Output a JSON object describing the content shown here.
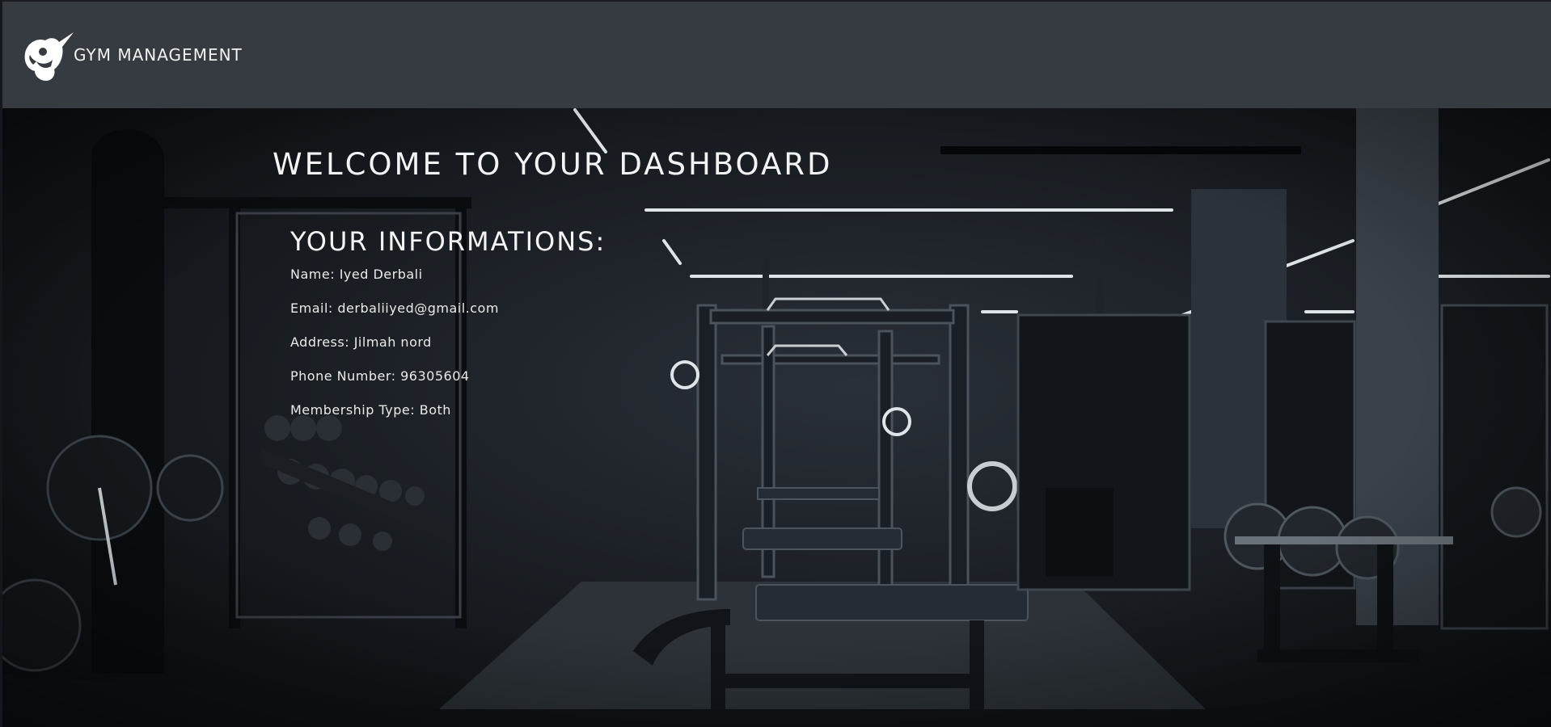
{
  "header": {
    "brand": "GYM MANAGEMENT",
    "logo_icon": "gym-mascot-logo"
  },
  "dashboard": {
    "welcome": "WELCOME TO YOUR DASHBOARD",
    "info_title": "YOUR INFORMATIONS:",
    "fields": [
      {
        "label": "Name:",
        "value": "Iyed Derbali"
      },
      {
        "label": "Email:",
        "value": "derbaliiyed@gmail.com"
      },
      {
        "label": "Address:",
        "value": "Jilmah nord"
      },
      {
        "label": "Phone Number:",
        "value": "96305604"
      },
      {
        "label": "Membership Type:",
        "value": "Both"
      }
    ]
  },
  "colors": {
    "header_bg": "#363a41",
    "text": "#f3f3f3"
  }
}
